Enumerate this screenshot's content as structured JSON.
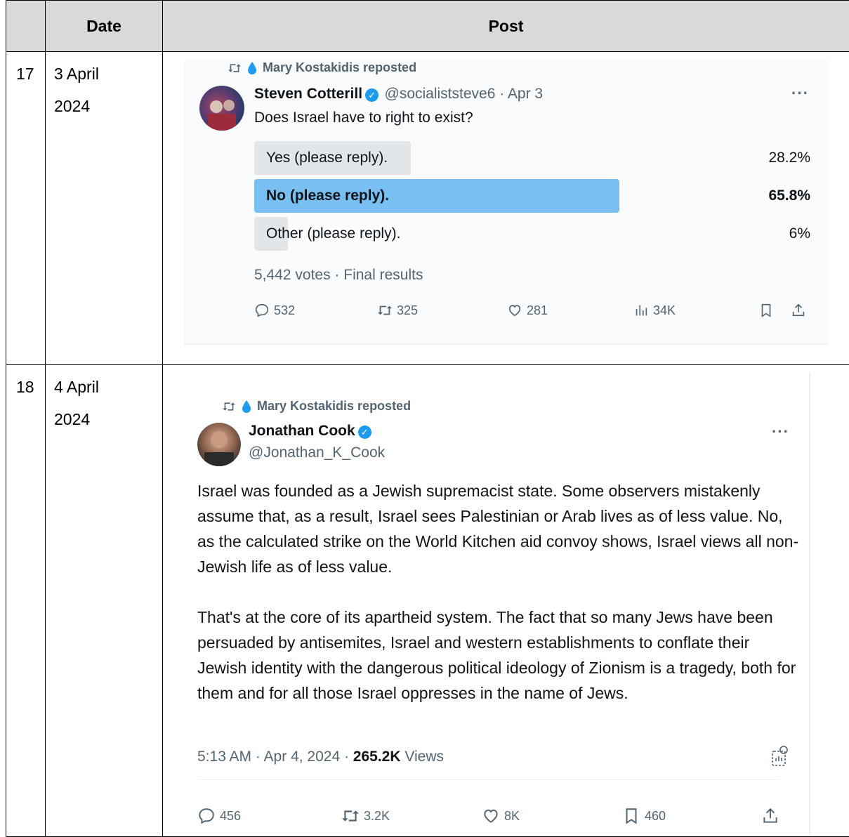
{
  "table": {
    "headers": [
      "",
      "Date",
      "Post"
    ],
    "rows": [
      {
        "num": "17",
        "date": "3 April 2024",
        "tweet": {
          "repost_label": "Mary Kostakidis reposted",
          "name": "Steven Cotterill",
          "handle": "@socialiststeve6 · Apr 3",
          "text": "Does Israel have to right to exist?",
          "poll": [
            {
              "label": "Yes (please reply).",
              "pct": "28.2%",
              "fraction": 0.282,
              "winner": false
            },
            {
              "label": "No (please reply).",
              "pct": "65.8%",
              "fraction": 0.658,
              "winner": true
            },
            {
              "label": "Other (please reply).",
              "pct": "6%",
              "fraction": 0.06,
              "winner": false
            }
          ],
          "poll_meta": "5,442 votes · Final results",
          "actions": {
            "replies": "532",
            "reposts": "325",
            "likes": "281",
            "views": "34K"
          }
        }
      },
      {
        "num": "18",
        "date": "4 April 2024",
        "tweet": {
          "repost_label": "Mary Kostakidis reposted",
          "name": "Jonathan Cook",
          "handle": "@Jonathan_K_Cook",
          "paragraph1": "Israel was founded as a Jewish supremacist state. Some observers mistakenly assume that, as a result, Israel sees Palestinian or Arab lives as of less value. No, as the calculated strike on the World Kitchen aid convoy shows, Israel views all non-Jewish life as of less value.",
          "paragraph2": "That's at the core of its apartheid system. The fact that so many Jews have been persuaded by antisemites, Israel and western establishments to conflate their  Jewish identity with the dangerous political ideology of Zionism is a tragedy, both for them and for all those Israel oppresses in the name of Jews.",
          "timestamp": "5:13 AM · Apr 4, 2024 · ",
          "views_count": "265.2K",
          "views_label": " Views",
          "actions": {
            "replies": "456",
            "reposts": "3.2K",
            "likes": "8K",
            "bookmarks": "460"
          }
        }
      }
    ]
  },
  "colors": {
    "accent": "#1d9bf0",
    "winner_bar": "#79c0f2",
    "poll_bar": "#e3e6e8",
    "header_bg": "#d9d9d9"
  }
}
